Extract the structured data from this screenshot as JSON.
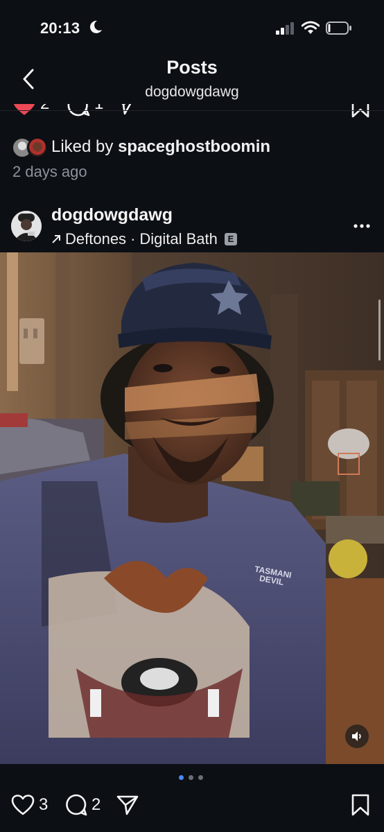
{
  "status_bar": {
    "time": "20:13"
  },
  "header": {
    "title": "Posts",
    "subtitle": "dogdowgdawg"
  },
  "liked": {
    "prefix": "Liked by ",
    "user": "spaceghostboomin",
    "time": "2 days ago"
  },
  "post": {
    "username": "dogdowgdawg",
    "music_artist": "Deftones",
    "music_separator": "·",
    "music_track": "Digital Bath",
    "explicit_badge": "E",
    "shirt_text_line1": "TASMANI",
    "shirt_text_line2": "DEVIL"
  },
  "prev_post": {
    "likes": "2",
    "comments": "1"
  },
  "carousel": {
    "total": 3,
    "active": 1
  },
  "actions": {
    "likes": "3",
    "comments": "2"
  },
  "colors": {
    "background": "#0c0f14",
    "accent_blue": "#4a8af4",
    "like_red": "#ed4956",
    "secondary_text": "#8d939b"
  }
}
